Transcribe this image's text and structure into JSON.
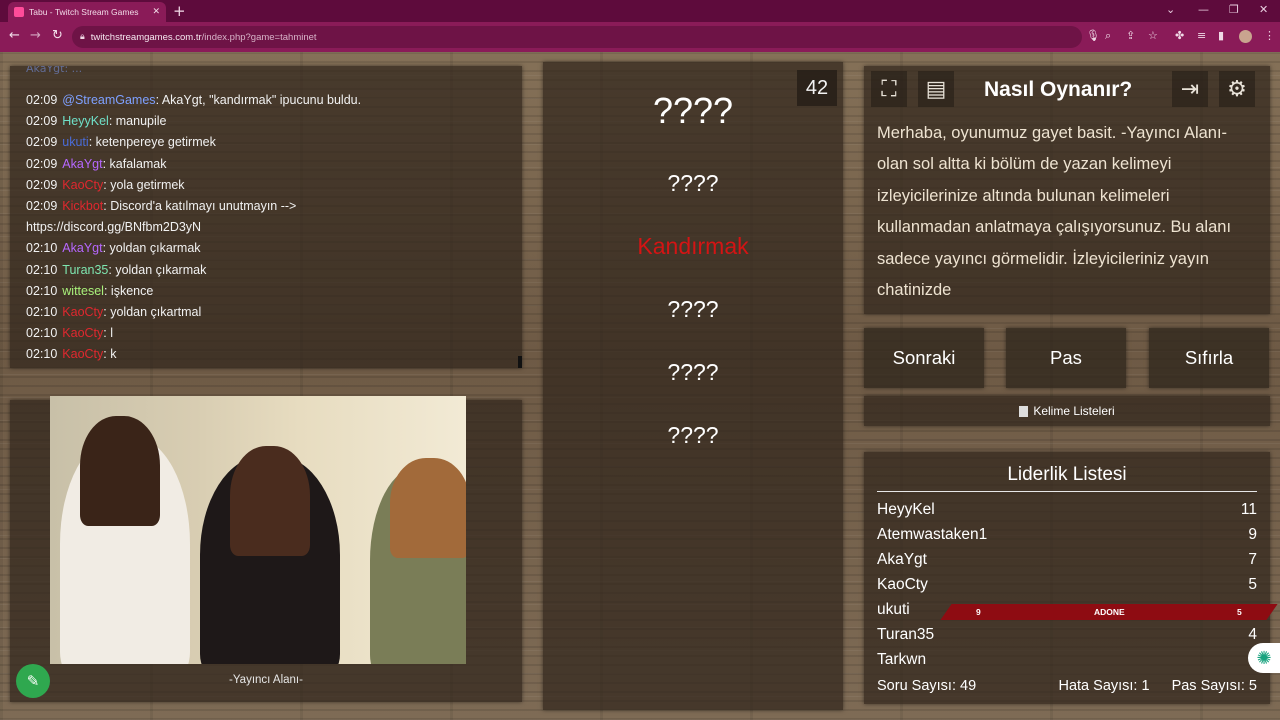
{
  "browser": {
    "tab_title": "Tabu - Twitch Stream Games",
    "tab_close": "✕",
    "new_tab": "+",
    "url_host": "twitchstreamgames.com.tr",
    "url_path": "/index.php?game=tahminet",
    "icons": {
      "back": "back-arrow-icon",
      "forward": "forward-arrow-icon",
      "reload": "reload-icon",
      "lock": "lock-icon",
      "mic": "microphone-icon",
      "search": "search-icon",
      "share": "share-icon",
      "star": "star-icon",
      "extensions": "puzzle-icon",
      "sidebar": "sidepanel-icon",
      "profile": "avatar-icon",
      "menu": "kebab-menu-icon"
    }
  },
  "chat": {
    "partial_top_line": "AkaYgt: ...",
    "messages": [
      {
        "time": "02:09",
        "user": "@StreamGames",
        "color": "#7ea0ff",
        "text": ": AkaYgt, \"kandırmak\" ipucunu buldu."
      },
      {
        "time": "02:09",
        "user": "HeyyKel",
        "color": "#6fe0c8",
        "text": ": manupile"
      },
      {
        "time": "02:09",
        "user": "ukuti",
        "color": "#4a6cd8",
        "text": ": ketenpereye getirmek"
      },
      {
        "time": "02:09",
        "user": "AkaYgt",
        "color": "#b667ff",
        "text": ": kafalamak"
      },
      {
        "time": "02:09",
        "user": "KaoCty",
        "color": "#e0282f",
        "text": ": yola getirmek"
      },
      {
        "time": "02:09",
        "user": "Kickbot",
        "color": "#e0282f",
        "text": ": Discord'a katılmayı unutmayın -->"
      },
      {
        "time": "",
        "user": "",
        "color": "#f1f1f1",
        "text": "https://discord.gg/BNfbm2D3yN"
      },
      {
        "time": "02:10",
        "user": "AkaYgt",
        "color": "#b667ff",
        "text": ": yoldan çıkarmak"
      },
      {
        "time": "02:10",
        "user": "Turan35",
        "color": "#7ee6b0",
        "text": ": yoldan çıkarmak"
      },
      {
        "time": "02:10",
        "user": "wittesel",
        "color": "#a8f07a",
        "text": ": işkence"
      },
      {
        "time": "02:10",
        "user": "KaoCty",
        "color": "#e0282f",
        "text": ": yoldan çıkartmal"
      },
      {
        "time": "02:10",
        "user": "KaoCty",
        "color": "#e0282f",
        "text": ": l"
      },
      {
        "time": "02:10",
        "user": "KaoCty",
        "color": "#e0282f",
        "text": ": k"
      }
    ]
  },
  "video": {
    "caption": "-Yayıncı Alanı-",
    "pen_button_icon": "pen-icon"
  },
  "game": {
    "timer": "42",
    "main_word": "????",
    "taboo_words": [
      {
        "text": "????",
        "found": false
      },
      {
        "text": "Kandırmak",
        "found": true
      },
      {
        "text": "????",
        "found": false
      },
      {
        "text": "????",
        "found": false
      },
      {
        "text": "????",
        "found": false
      }
    ]
  },
  "howto": {
    "title": "Nasıl Oynanır?",
    "text": "Merhaba, oyunumuz gayet basit. -Yayıncı Alanı- olan sol altta ki bölüm de yazan kelimeyi izleyicilerinize altında bulunan kelimeleri kullanmadan anlatmaya çalışıyorsunuz. Bu alanı sadece yayıncı görmelidir. İzleyicileriniz yayın chatinizde",
    "icons": {
      "fullscreen": "fullscreen-icon",
      "document": "document-icon",
      "exit": "exit-icon",
      "settings": "gear-icon"
    }
  },
  "actions": {
    "next": "Sonraki",
    "pass": "Pas",
    "reset": "Sıfırla",
    "word_lists": "Kelime Listeleri"
  },
  "leaderboard": {
    "title": "Liderlik Listesi",
    "rows": [
      {
        "name": "HeyyKel",
        "score": "11"
      },
      {
        "name": "Atemwastaken1",
        "score": "9"
      },
      {
        "name": "AkaYgt",
        "score": "7"
      },
      {
        "name": "KaoCty",
        "score": "5"
      },
      {
        "name": "ukuti",
        "score": ""
      },
      {
        "name": "Turan35",
        "score": "4"
      },
      {
        "name": "Tarkwn",
        "score": ""
      }
    ],
    "banner": {
      "left": "9",
      "center": "ADONE",
      "right": "5"
    },
    "question_count_label": "Soru Sayısı: 49",
    "error_count_label": "Hata Sayısı: 1",
    "pass_count_label": "Pas Sayısı: 5"
  }
}
